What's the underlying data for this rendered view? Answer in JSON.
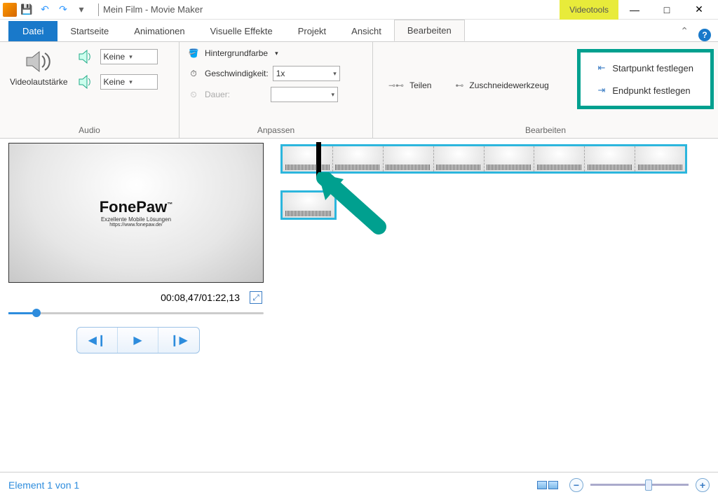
{
  "title": "Mein Film - Movie Maker",
  "videotools_label": "Videotools",
  "tabs": {
    "datei": "Datei",
    "startseite": "Startseite",
    "animationen": "Animationen",
    "visuelle": "Visuelle Effekte",
    "projekt": "Projekt",
    "ansicht": "Ansicht",
    "bearbeiten": "Bearbeiten"
  },
  "ribbon": {
    "audio": {
      "videolautstaerke": "Videolautstärke",
      "fadein": "Keine",
      "fadeout": "Keine",
      "group": "Audio"
    },
    "anpassen": {
      "hintergrundfarbe": "Hintergrundfarbe",
      "geschwindigkeit_label": "Geschwindigkeit:",
      "geschwindigkeit_value": "1x",
      "dauer_label": "Dauer:",
      "dauer_value": "",
      "group": "Anpassen"
    },
    "bearbeiten": {
      "teilen": "Teilen",
      "zuschneidewerkzeug": "Zuschneidewerkzeug",
      "startpunkt": "Startpunkt festlegen",
      "endpunkt": "Endpunkt festlegen",
      "group": "Bearbeiten"
    }
  },
  "preview": {
    "logo_main": "FonePaw",
    "logo_sub": "Exzellente Mobile Lösungen",
    "logo_url": "https://www.fonepaw.de/",
    "time": "00:08,47/01:22,13"
  },
  "status": {
    "text": "Element 1 von 1"
  }
}
